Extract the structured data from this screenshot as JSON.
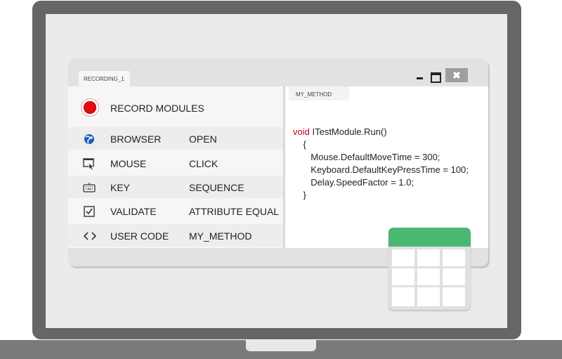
{
  "window": {
    "tab_label": "RECORDING_1",
    "close_glyph": "✖"
  },
  "modules": {
    "record_label": "RECORD MODULES",
    "items": [
      {
        "name": "BROWSER",
        "action": "OPEN",
        "icon": "browser-globe-icon"
      },
      {
        "name": "MOUSE",
        "action": "CLICK",
        "icon": "mouse-cursor-icon"
      },
      {
        "name": "KEY",
        "action": "SEQUENCE",
        "icon": "keyboard-icon"
      },
      {
        "name": "VALIDATE",
        "action": "ATTRIBUTE EQUAL",
        "icon": "checkbox-icon"
      },
      {
        "name": "USER CODE",
        "action": "MY_METHOD",
        "icon": "code-brackets-icon"
      }
    ]
  },
  "code": {
    "tab_label": "MY_METHOD",
    "keyword": "void",
    "signature": " ITestModule.Run()",
    "lines": [
      "    {",
      "       Mouse.DefaultMoveTime = 300;",
      "       Keyboard.DefaultKeyPressTime = 100;",
      "       Delay.SpeedFactor = 1.0;",
      "    }"
    ]
  },
  "colors": {
    "record": "#e01010",
    "keyword": "#c8001e",
    "table_header": "#4cb673",
    "frame": "#666666"
  }
}
